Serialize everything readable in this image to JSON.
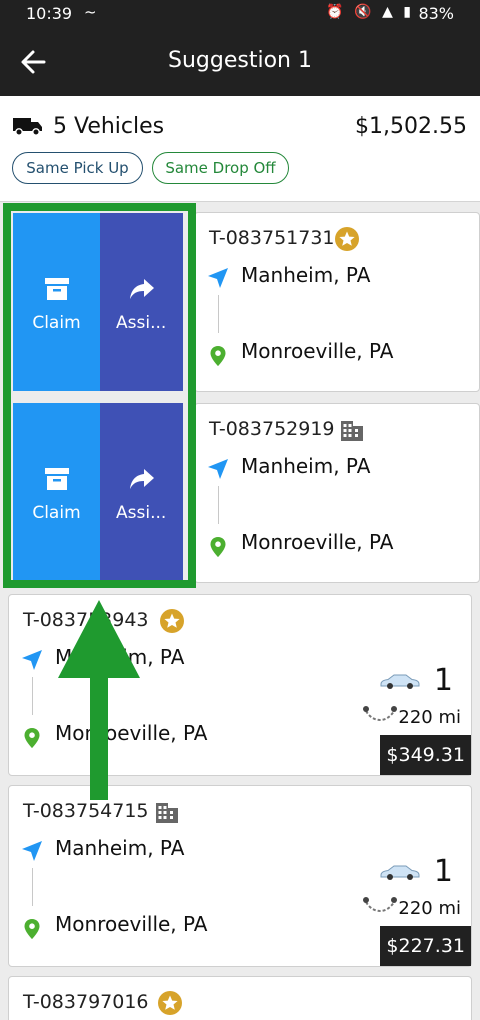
{
  "status_bar": {
    "time": "10:39",
    "battery": "83%"
  },
  "header": {
    "title": "Suggestion 1",
    "back_icon": "arrow-left-icon"
  },
  "summary": {
    "vehicles": "5 Vehicles",
    "total": "$1,502.55",
    "chips": [
      "Same Pick Up",
      "Same Drop Off"
    ]
  },
  "swipe_actions": {
    "claim_label": "Claim",
    "assign_label": "Assi..."
  },
  "loads": [
    {
      "id": "T-083751731",
      "badge": "star",
      "origin": "Manheim, PA",
      "destination": "Monroeville, PA"
    },
    {
      "id": "T-083752919",
      "badge": "building",
      "origin": "Manheim, PA",
      "destination": "Monroeville, PA"
    },
    {
      "id": "T-083753943",
      "badge": "star",
      "origin": "Manheim, PA",
      "destination": "Monroeville, PA",
      "vehicles": "1",
      "distance": "220 mi",
      "price": "$349.31"
    },
    {
      "id": "T-083754715",
      "badge": "building",
      "origin": "Manheim, PA",
      "destination": "Monroeville, PA",
      "vehicles": "1",
      "distance": "220 mi",
      "price": "$227.31"
    },
    {
      "id": "T-083797016",
      "badge": "star"
    }
  ],
  "colors": {
    "claim": "#2196f3",
    "assign": "#3f51b5",
    "highlight": "#1f9a2f",
    "star": "#d7a32a",
    "pin": "#4caf30",
    "nav": "#2196f3"
  }
}
